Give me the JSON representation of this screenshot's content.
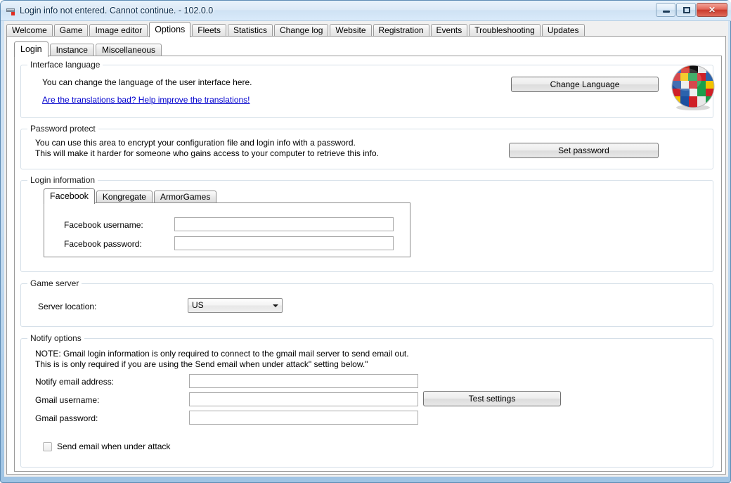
{
  "window": {
    "title": "Login info not entered. Cannot continue. - 102.0.0",
    "icon": "app-icon",
    "buttons": {
      "minimize": "minimize",
      "maximize": "maximize",
      "close": "✕"
    }
  },
  "main_tabs": [
    {
      "label": "Welcome",
      "selected": false
    },
    {
      "label": "Game",
      "selected": false
    },
    {
      "label": "Image editor",
      "selected": false
    },
    {
      "label": "Options",
      "selected": true
    },
    {
      "label": "Fleets",
      "selected": false
    },
    {
      "label": "Statistics",
      "selected": false
    },
    {
      "label": "Change log",
      "selected": false
    },
    {
      "label": "Website",
      "selected": false
    },
    {
      "label": "Registration",
      "selected": false
    },
    {
      "label": "Events",
      "selected": false
    },
    {
      "label": "Troubleshooting",
      "selected": false
    },
    {
      "label": "Updates",
      "selected": false
    }
  ],
  "options_tabs": [
    {
      "label": "Login",
      "selected": true
    },
    {
      "label": "Instance",
      "selected": false
    },
    {
      "label": "Miscellaneous",
      "selected": false
    }
  ],
  "interface_language": {
    "legend": "Interface language",
    "description": "You can change the language of the user interface here.",
    "link": "Are the translations bad? Help improve the translations!",
    "change_button": "Change Language",
    "globe_icon": "flags-globe-icon"
  },
  "password_protect": {
    "legend": "Password protect",
    "line1": "You can use this area to encrypt your configuration file and login info with a password.",
    "line2": "This will make it harder for someone who gains access to your computer to retrieve this info.",
    "set_button": "Set password"
  },
  "login_information": {
    "legend": "Login information",
    "tabs": [
      {
        "label": "Facebook",
        "selected": true
      },
      {
        "label": "Kongregate",
        "selected": false
      },
      {
        "label": "ArmorGames",
        "selected": false
      }
    ],
    "username_label": "Facebook username:",
    "username_value": "",
    "password_label": "Facebook password:",
    "password_value": ""
  },
  "game_server": {
    "legend": "Game server",
    "server_location_label": "Server location:",
    "server_location_value": "US",
    "server_location_options": [
      "US"
    ]
  },
  "notify_options": {
    "legend": "Notify options",
    "note_line1": "NOTE: Gmail login information is only required to connect to the gmail mail server to send email out.",
    "note_line2": "This is is only required if you are using the Send email when under attack\" setting below.\"",
    "notify_email_label": "Notify email address:",
    "notify_email_value": "",
    "gmail_username_label": "Gmail username:",
    "gmail_username_value": "",
    "gmail_password_label": "Gmail password:",
    "gmail_password_value": "",
    "test_button": "Test settings",
    "checkbox_label": "Send email when under attack",
    "checkbox_checked": false
  },
  "colors": {
    "accent": "#0000cd",
    "title_bar": "#d9eafa",
    "frame": "#9fc4e4",
    "close_button": "#c93a2c"
  }
}
